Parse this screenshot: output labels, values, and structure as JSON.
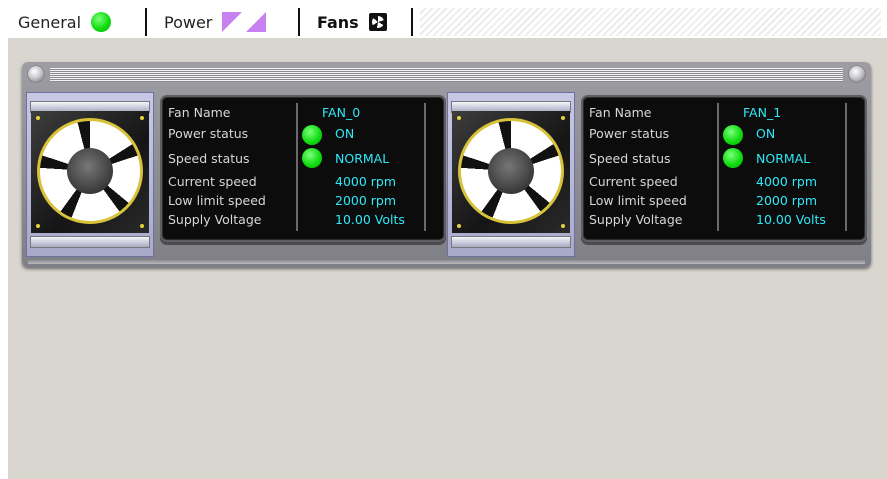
{
  "tabs": [
    {
      "label": "General",
      "icon": "status-led-icon",
      "active": false
    },
    {
      "label": "Power",
      "icon": "power-triangles-icon",
      "active": false
    },
    {
      "label": "Fans",
      "icon": "fan-icon",
      "active": true
    }
  ],
  "fields": {
    "fan_name": "Fan Name",
    "power_status": "Power status",
    "speed_status": "Speed status",
    "current_speed": "Current speed",
    "low_limit_speed": "Low limit speed",
    "supply_voltage": "Supply Voltage"
  },
  "fans": [
    {
      "name": "FAN_0",
      "power_status": "ON",
      "speed_status": "NORMAL",
      "current_speed": "4000 rpm",
      "low_limit_speed": "2000 rpm",
      "supply_voltage": "10.00 Volts"
    },
    {
      "name": "FAN_1",
      "power_status": "ON",
      "speed_status": "NORMAL",
      "current_speed": "4000 rpm",
      "low_limit_speed": "2000 rpm",
      "supply_voltage": "10.00 Volts"
    }
  ],
  "colors": {
    "led_green": "#12dd12",
    "value_cyan": "#2fe8f8",
    "power_icon_purple": "#c680f0",
    "background": "#d8d6cf"
  }
}
